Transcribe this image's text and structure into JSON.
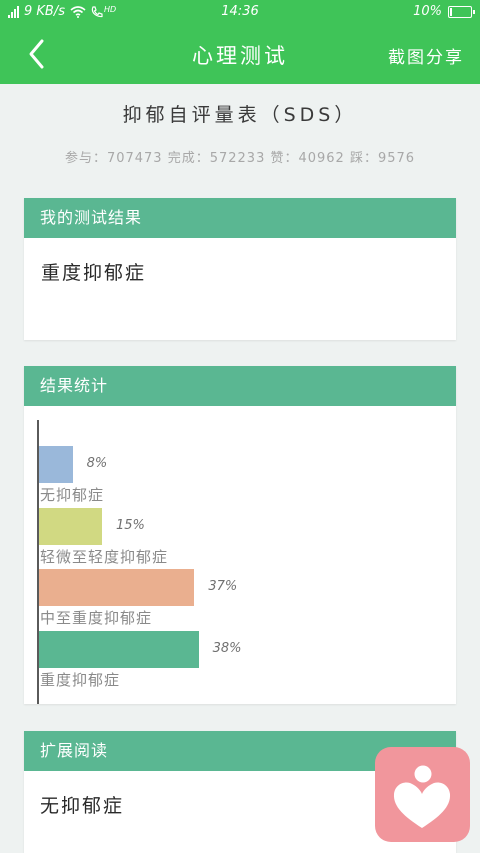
{
  "status_bar": {
    "network_speed": "9 KB/s",
    "hd_label": "HD",
    "time": "14:36",
    "battery": "10%",
    "battery_level": 0.1
  },
  "nav": {
    "back_icon": "chevron-left-icon",
    "title": "心理测试",
    "share_label": "截图分享"
  },
  "test": {
    "title": "抑郁自评量表（SDS）",
    "stats": "参与：707473 完成：572233 赞：40962 踩：9576"
  },
  "result_card": {
    "header": "我的测试结果",
    "result": "重度抑郁症"
  },
  "stats_card": {
    "header": "结果统计"
  },
  "chart_data": {
    "type": "bar",
    "orientation": "horizontal",
    "categories": [
      "无抑郁症",
      "轻微至轻度抑郁症",
      "中至重度抑郁症",
      "重度抑郁症"
    ],
    "values": [
      8,
      15,
      37,
      38
    ],
    "value_labels": [
      "8%",
      "15%",
      "37%",
      "38%"
    ],
    "colors": [
      "#9ab8da",
      "#d1d982",
      "#eaaf8f",
      "#5ab792"
    ],
    "unit": "%"
  },
  "reading_card": {
    "header": "扩展阅读",
    "text": "无抑郁症"
  },
  "fab": {
    "icon": "heart-person-icon",
    "color": "#f1969c"
  },
  "colors": {
    "green_bar": "#3fc458",
    "card_header": "#5ab792"
  }
}
